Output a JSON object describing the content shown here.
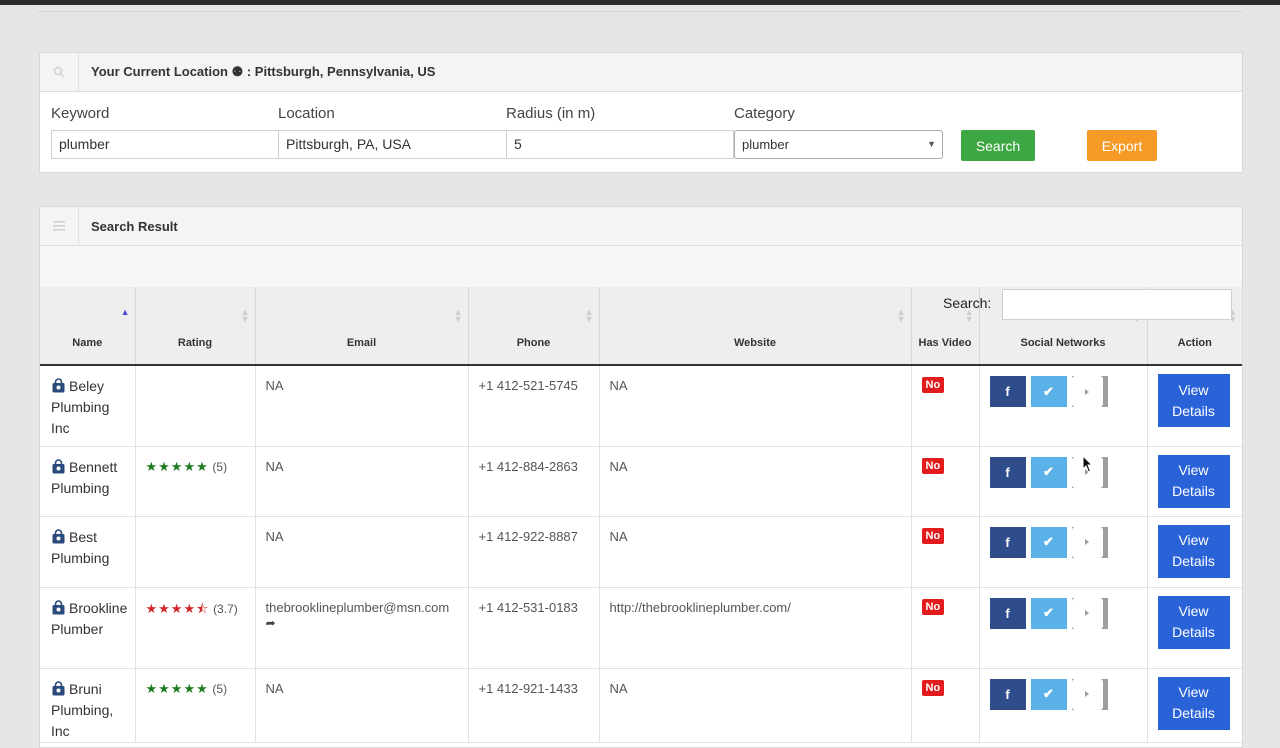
{
  "location_panel": {
    "title": "Your Current Location ⚉ : Pittsburgh, Pennsylvania, US",
    "keyword_label": "Keyword",
    "keyword_value": "plumber",
    "location_label": "Location",
    "location_value": "Pittsburgh, PA, USA",
    "radius_label": "Radius (in m)",
    "radius_value": "5",
    "category_label": "Category",
    "category_value": "plumber",
    "search_button": "Search",
    "export_button": "Export"
  },
  "results_panel": {
    "title": "Search Result",
    "search_label": "Search:",
    "search_value": "",
    "columns": [
      "Name",
      "Rating",
      "Email",
      "Phone",
      "Website",
      "Has Video",
      "Social Networks",
      "Action"
    ],
    "rows": [
      {
        "name": "Beley Plumbing Inc",
        "stars": "",
        "rating": "",
        "email": "NA",
        "phone": "+1 412-521-5745",
        "website": "NA",
        "has_video": "No",
        "action": "View Details"
      },
      {
        "name": "Bennett Plumbing",
        "stars": "★★★★★",
        "rating": "(5)",
        "email": "NA",
        "phone": "+1 412-884-2863",
        "website": "NA",
        "has_video": "No",
        "action": "View Details"
      },
      {
        "name": "Best Plumbing",
        "stars": "",
        "rating": "",
        "email": "NA",
        "phone": "+1 412-922-8887",
        "website": "NA",
        "has_video": "No",
        "action": "View Details"
      },
      {
        "name": "Brookline Plumber",
        "stars": "★★★★",
        "rating": "(3.7)",
        "email": "thebrooklineplumber@msn.com",
        "phone": "+1 412-531-0183",
        "website": "http://thebrooklineplumber.com/",
        "has_video": "No",
        "action": "View Details"
      },
      {
        "name": "Bruni Plumbing, Inc",
        "stars": "★★★★★",
        "rating": "(5)",
        "email": "NA",
        "phone": "+1 412-921-1433",
        "website": "NA",
        "has_video": "No",
        "action": "View Details"
      }
    ]
  },
  "colors": {
    "search_button": "#3da843",
    "export_button": "#f59a24",
    "view_button": "#2a63d8",
    "badge_no": "#e21c1c",
    "facebook": "#2f4d8b",
    "twitter": "#5bb2e8",
    "youtube": "#9e9e9e"
  }
}
